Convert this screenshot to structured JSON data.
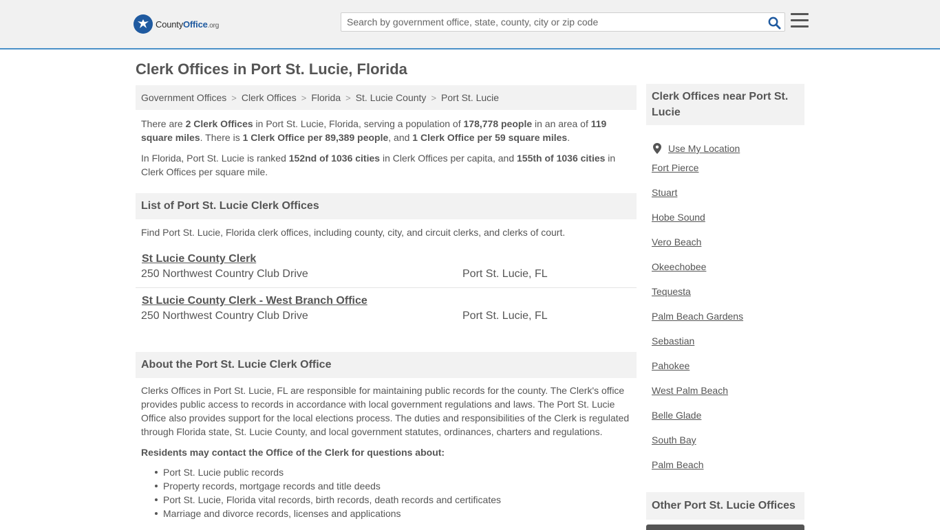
{
  "header": {
    "logo_county": "County",
    "logo_office": "Office",
    "logo_org": ".org",
    "search_placeholder": "Search by government office, state, county, city or zip code"
  },
  "page_title": "Clerk Offices in Port St. Lucie, Florida",
  "breadcrumb": [
    "Government Offices",
    "Clerk Offices",
    "Florida",
    "St. Lucie County",
    "Port St. Lucie"
  ],
  "intro": {
    "p1": {
      "t1": "There are ",
      "b1": "2 Clerk Offices",
      "t2": " in Port St. Lucie, Florida, serving a population of ",
      "b2": "178,778 people",
      "t3": " in an area of ",
      "b3": "119 square miles",
      "t4": ". There is ",
      "b4": "1 Clerk Office per 89,389 people",
      "t5": ", and ",
      "b5": "1 Clerk Office per 59 square miles",
      "t6": "."
    },
    "p2": {
      "t1": "In Florida, Port St. Lucie is ranked ",
      "b1": "152nd of 1036 cities",
      "t2": " in Clerk Offices per capita, and ",
      "b2": "155th of 1036 cities",
      "t3": " in Clerk Offices per square mile."
    }
  },
  "list_section": {
    "heading": "List of Port St. Lucie Clerk Offices",
    "description": "Find Port St. Lucie, Florida clerk offices, including county, city, and circuit clerks, and clerks of court.",
    "offices": [
      {
        "name": "St Lucie County Clerk",
        "address": "250 Northwest Country Club Drive",
        "city": "Port St. Lucie, FL"
      },
      {
        "name": "St Lucie County Clerk - West Branch Office",
        "address": "250 Northwest Country Club Drive",
        "city": "Port St. Lucie, FL"
      }
    ]
  },
  "about_section": {
    "heading": "About the Port St. Lucie Clerk Office",
    "body": "Clerks Offices in Port St. Lucie, FL are responsible for maintaining public records for the county. The Clerk's office provides public access to records in accordance with local government regulations and laws. The Port St. Lucie Office also provides support for the local elections process. The duties and responsibilities of the Clerk is regulated through Florida state, St. Lucie County, and local government statutes, ordinances, charters and regulations.",
    "residents_heading": "Residents may contact the Office of the Clerk for questions about:",
    "bullets": [
      "Port St. Lucie public records",
      "Property records, mortgage records and title deeds",
      "Port St. Lucie, Florida vital records, birth records, death records and certificates",
      "Marriage and divorce records, licenses and applications"
    ]
  },
  "sidebar": {
    "heading": "Clerk Offices near Port St. Lucie",
    "use_location": "Use My Location",
    "nearby": [
      "Fort Pierce",
      "Stuart",
      "Hobe Sound",
      "Vero Beach",
      "Okeechobee",
      "Tequesta",
      "Palm Beach Gardens",
      "Sebastian",
      "Pahokee",
      "West Palm Beach",
      "Belle Glade",
      "South Bay",
      "Palm Beach"
    ],
    "other_heading": "Other Port St. Lucie Offices"
  },
  "colors": {
    "accent": "#4a90c8",
    "logo_blue": "#1f5aa0",
    "search_icon": "#1f5aa0",
    "text": "#555555",
    "panel_bg": "#f2f2f2"
  }
}
